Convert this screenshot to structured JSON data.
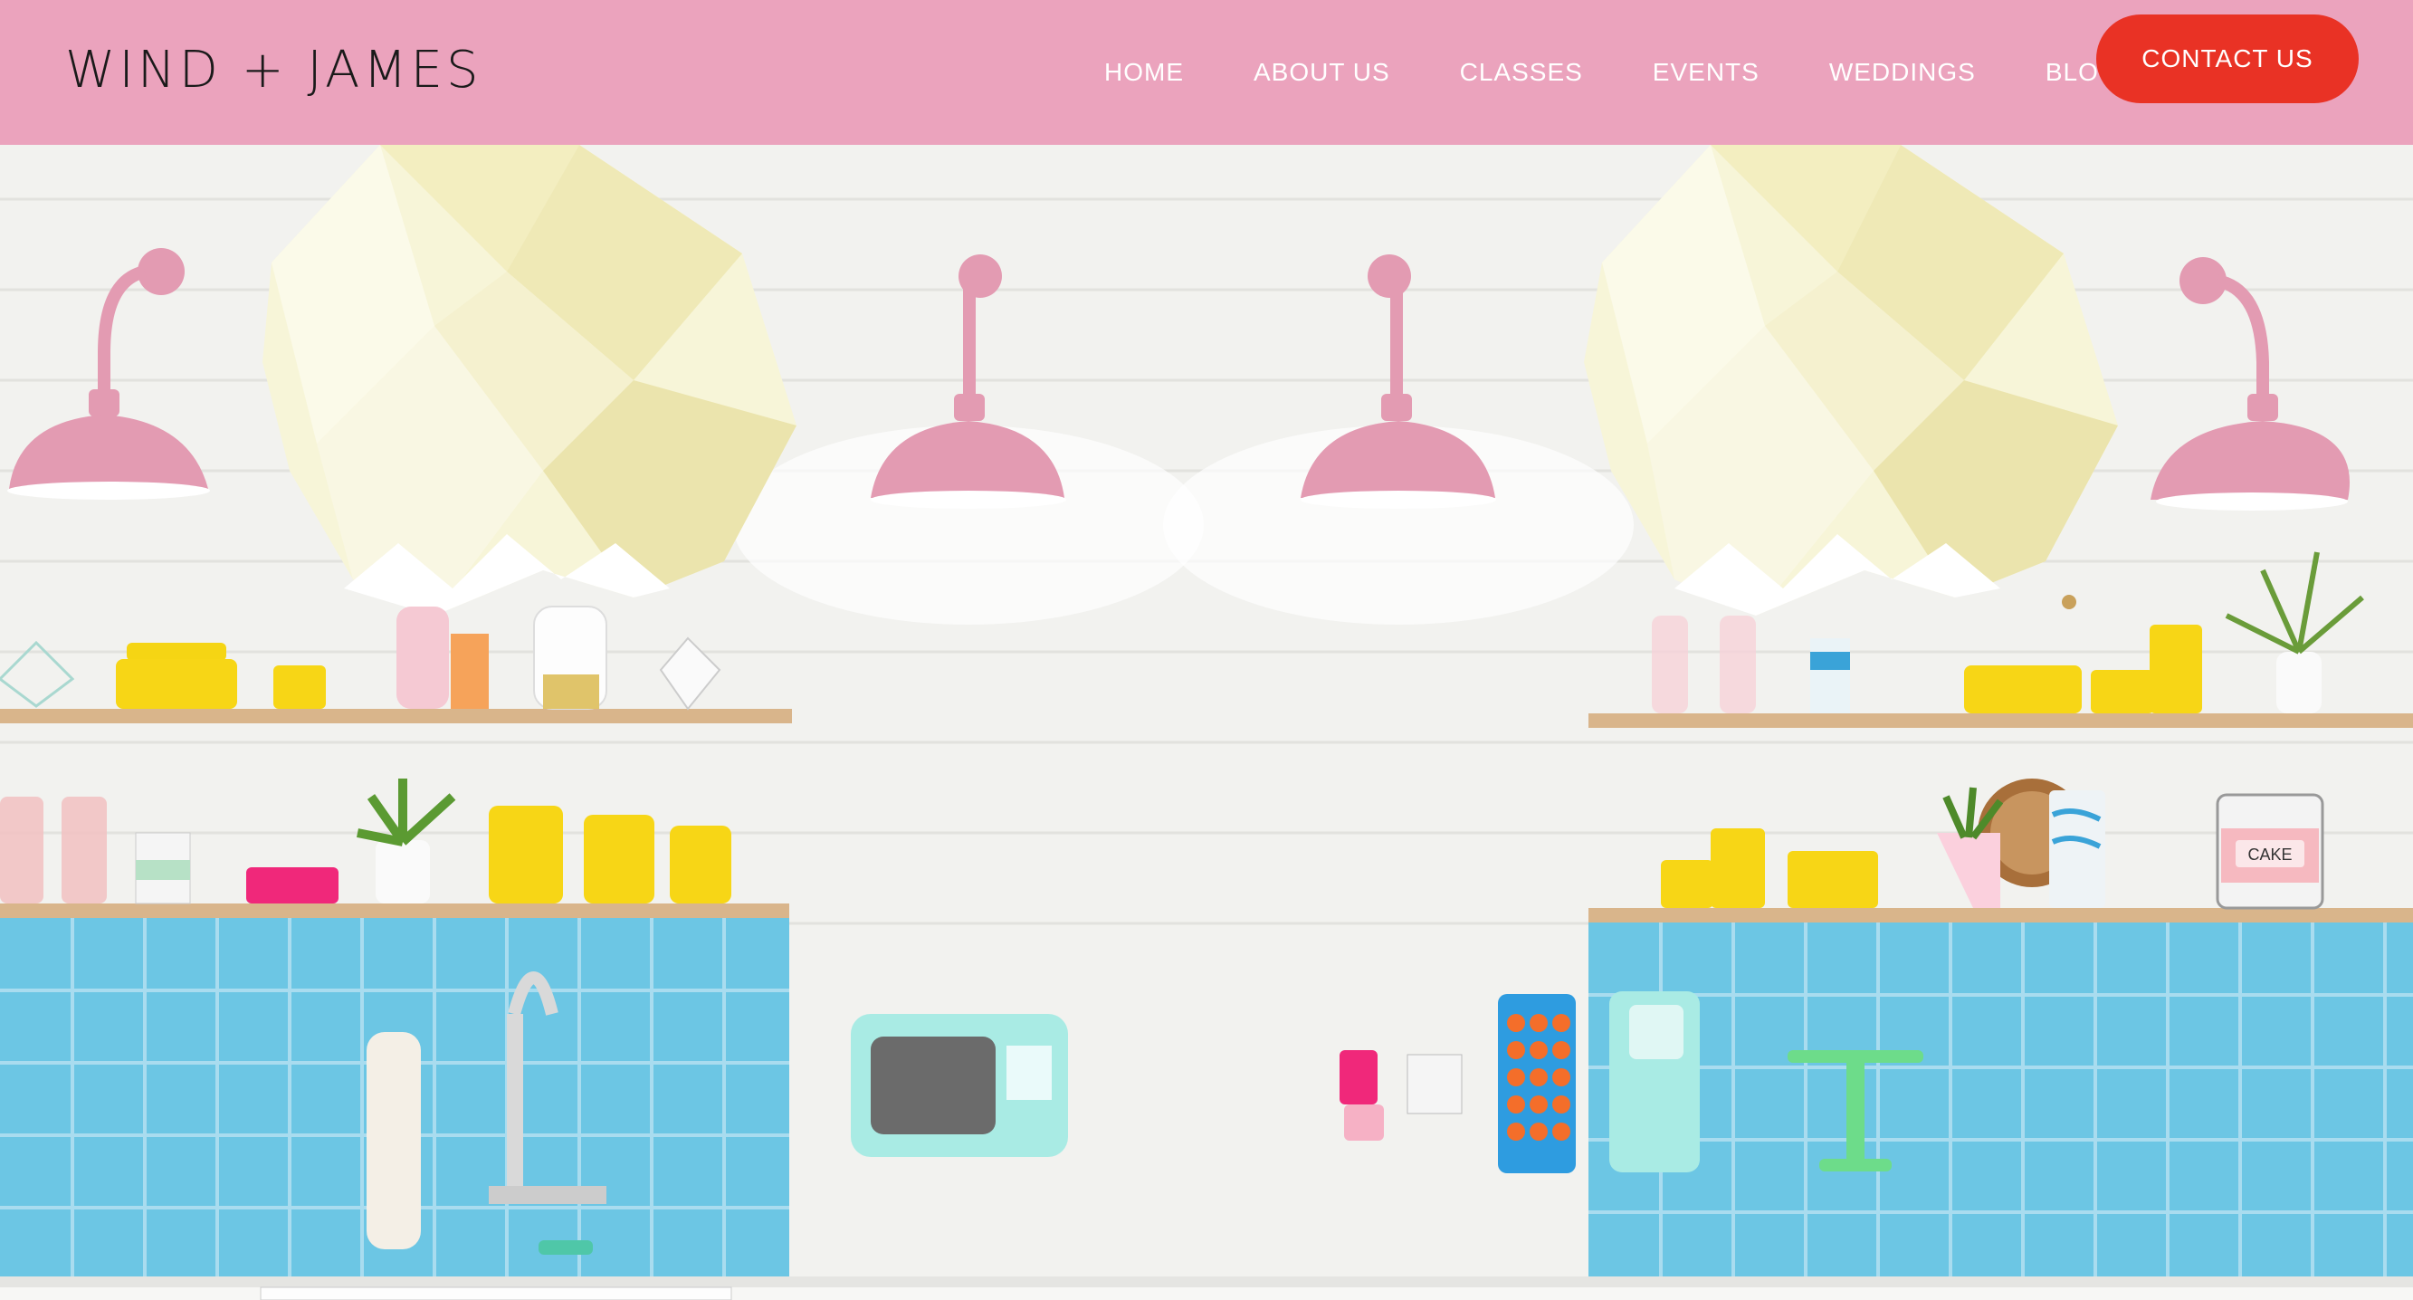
{
  "brand": {
    "logo_text": "WIND + JAMES"
  },
  "nav": {
    "items": [
      {
        "label": "HOME"
      },
      {
        "label": "ABOUT US"
      },
      {
        "label": "CLASSES"
      },
      {
        "label": "EVENTS"
      },
      {
        "label": "WEDDINGS"
      },
      {
        "label": "BLOG"
      }
    ],
    "contact_label": "CONTACT US"
  },
  "hero": {
    "canister_label": "CAKE"
  },
  "colors": {
    "header": "#eba3bd",
    "contact_button": "#e93225",
    "tile_blue": "#6cc6e4",
    "lamp_pink": "#e39bb2"
  }
}
